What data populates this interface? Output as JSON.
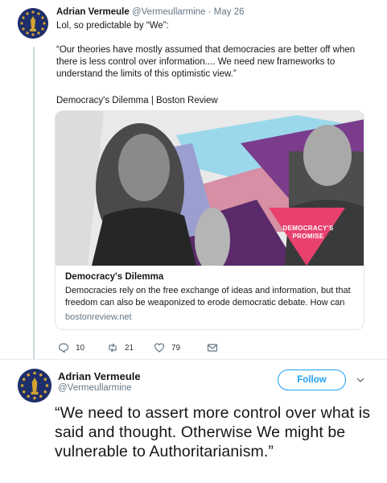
{
  "tweet1": {
    "author_name": "Adrian Vermeule",
    "author_handle": "@Vermeullarmine",
    "separator": "·",
    "date": "May 26",
    "text": "Lol, so predictable by “We”:",
    "quote": "“Our theories have mostly assumed that democracies are better off when there is less control over information.... We need new frameworks to understand the limits of this optimistic view.”",
    "source": "Democracy's Dilemma | Boston Review",
    "card": {
      "image_banner": "DEMOCRACY'S PROMISE",
      "title": "Democracy's Dilemma",
      "description": "Democracies rely on the free exchange of ideas and information, but that freedom can also be weaponized to erode democratic debate. How can",
      "domain": "bostonreview.net"
    },
    "actions": {
      "reply_count": "10",
      "retweet_count": "21",
      "like_count": "79"
    }
  },
  "tweet2": {
    "author_name": "Adrian Vermeule",
    "author_handle": "@Vermeullarmine",
    "follow_label": "Follow",
    "text": "“We need to assert more control over what is said and thought. Otherwise We might be vulnerable to Authoritarianism.”"
  },
  "colors": {
    "accent": "#1da1f2",
    "secondary_text": "#657786",
    "avatar_bg": "#1f2f6b",
    "avatar_gold": "#d4a531"
  }
}
